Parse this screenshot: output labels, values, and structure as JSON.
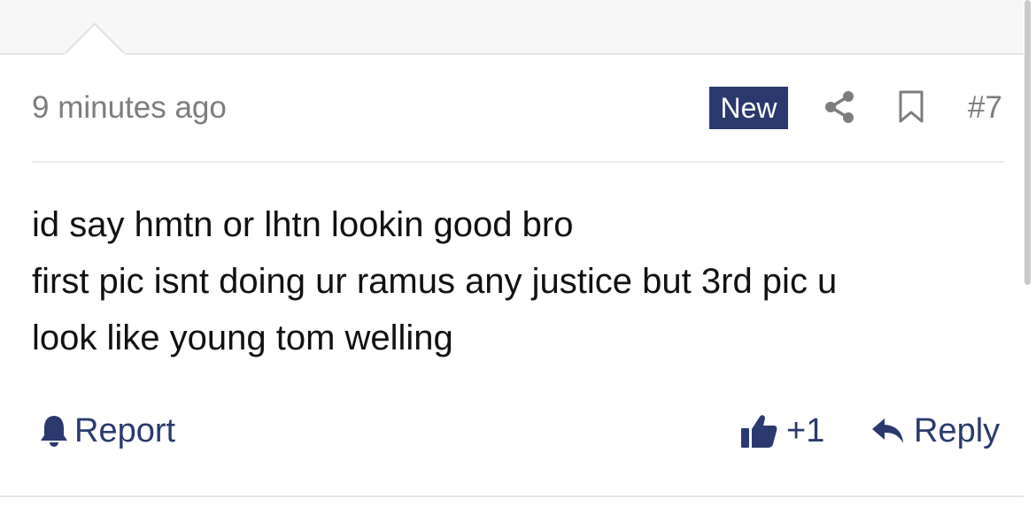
{
  "post": {
    "timestamp": "9 minutes ago",
    "badge": "New",
    "number": "#7",
    "body_lines": [
      "id say hmtn or lhtn lookin good bro",
      "first pic isnt doing ur ramus any justice but 3rd pic u",
      "look like young tom welling"
    ]
  },
  "actions": {
    "report_label": "Report",
    "like_count": "+1",
    "reply_label": "Reply"
  },
  "colors": {
    "accent": "#2a3a6e",
    "meta_text": "#7d7d7d",
    "body_text": "#111111"
  },
  "icons": [
    "share-icon",
    "bookmark-icon",
    "bell-icon",
    "thumbs-up-icon",
    "reply-arrow-icon"
  ]
}
